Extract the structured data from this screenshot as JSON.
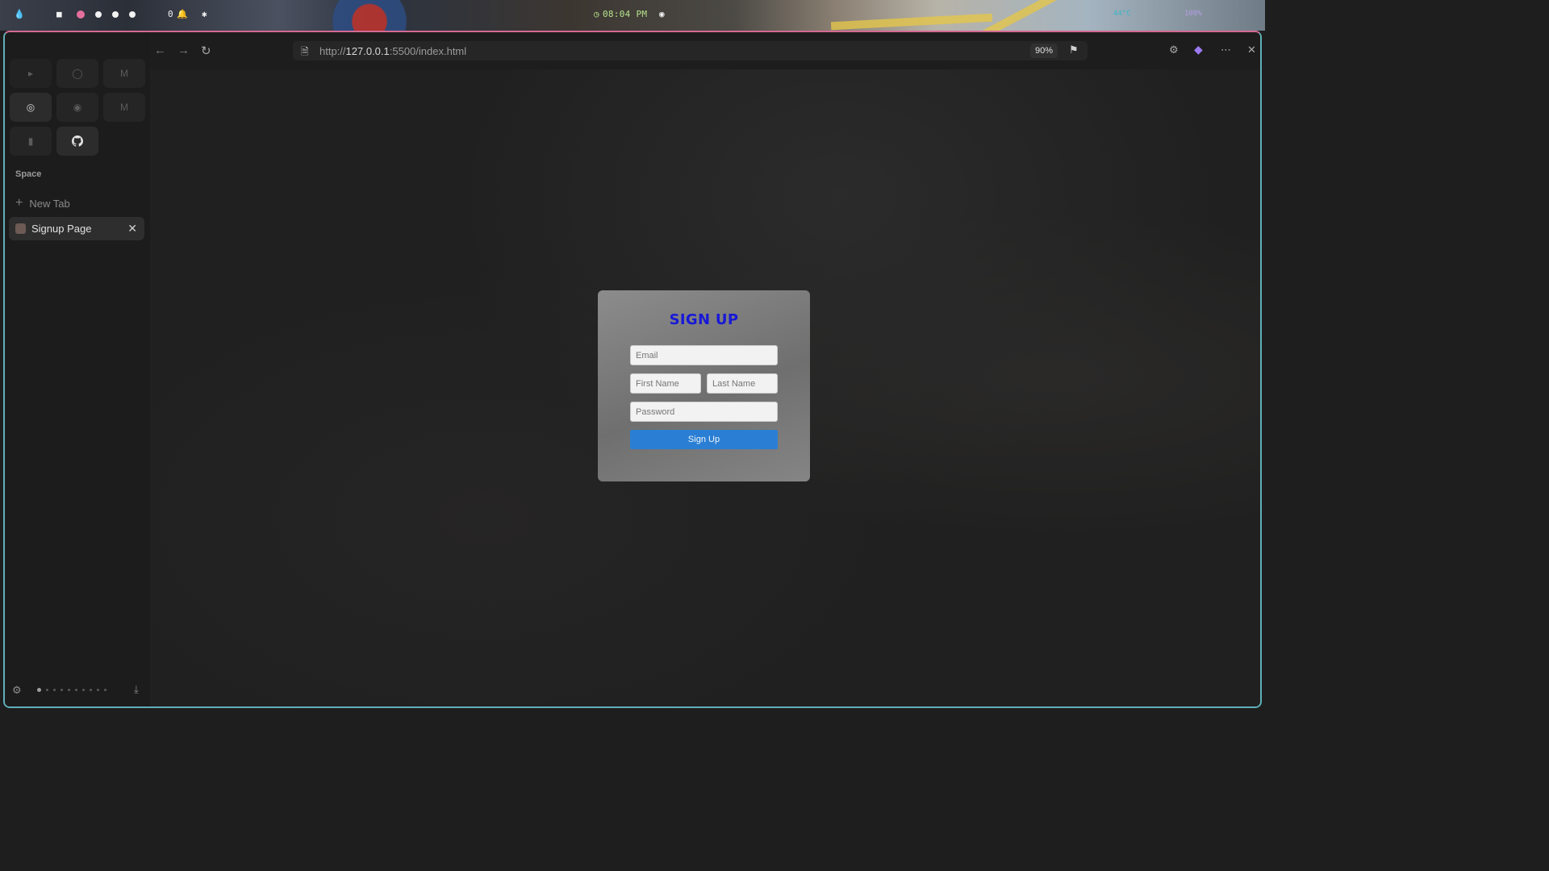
{
  "desktop": {
    "clock": "08:04 PM",
    "temperature": "44°C",
    "volume": "100%"
  },
  "browser": {
    "nav": {
      "back_icon": "back-arrow-icon",
      "forward_icon": "forward-arrow-icon",
      "reload_icon": "reload-icon"
    },
    "url": {
      "scheme": "http://",
      "host": "127.0.0.1",
      "rest": ":5500/index.html"
    },
    "zoom": "90%",
    "sidebar": {
      "pinned": [
        {
          "name": "youtube-icon"
        },
        {
          "name": "whatsapp-icon"
        },
        {
          "name": "gmail-icon"
        },
        {
          "name": "chatgpt-icon"
        },
        {
          "name": "reddit-icon"
        },
        {
          "name": "mail-icon"
        },
        {
          "name": "extension-icon"
        },
        {
          "name": "github-icon"
        }
      ],
      "space_label": "Space",
      "new_tab_label": "New Tab",
      "tabs": [
        {
          "label": "Signup Page"
        }
      ]
    }
  },
  "form": {
    "title": "SIGN UP",
    "email_placeholder": "Email",
    "first_name_placeholder": "First Name",
    "last_name_placeholder": "Last Name",
    "password_placeholder": "Password",
    "submit_label": "Sign Up",
    "title_color": "#1818d8",
    "button_color": "#2a7fd4"
  }
}
